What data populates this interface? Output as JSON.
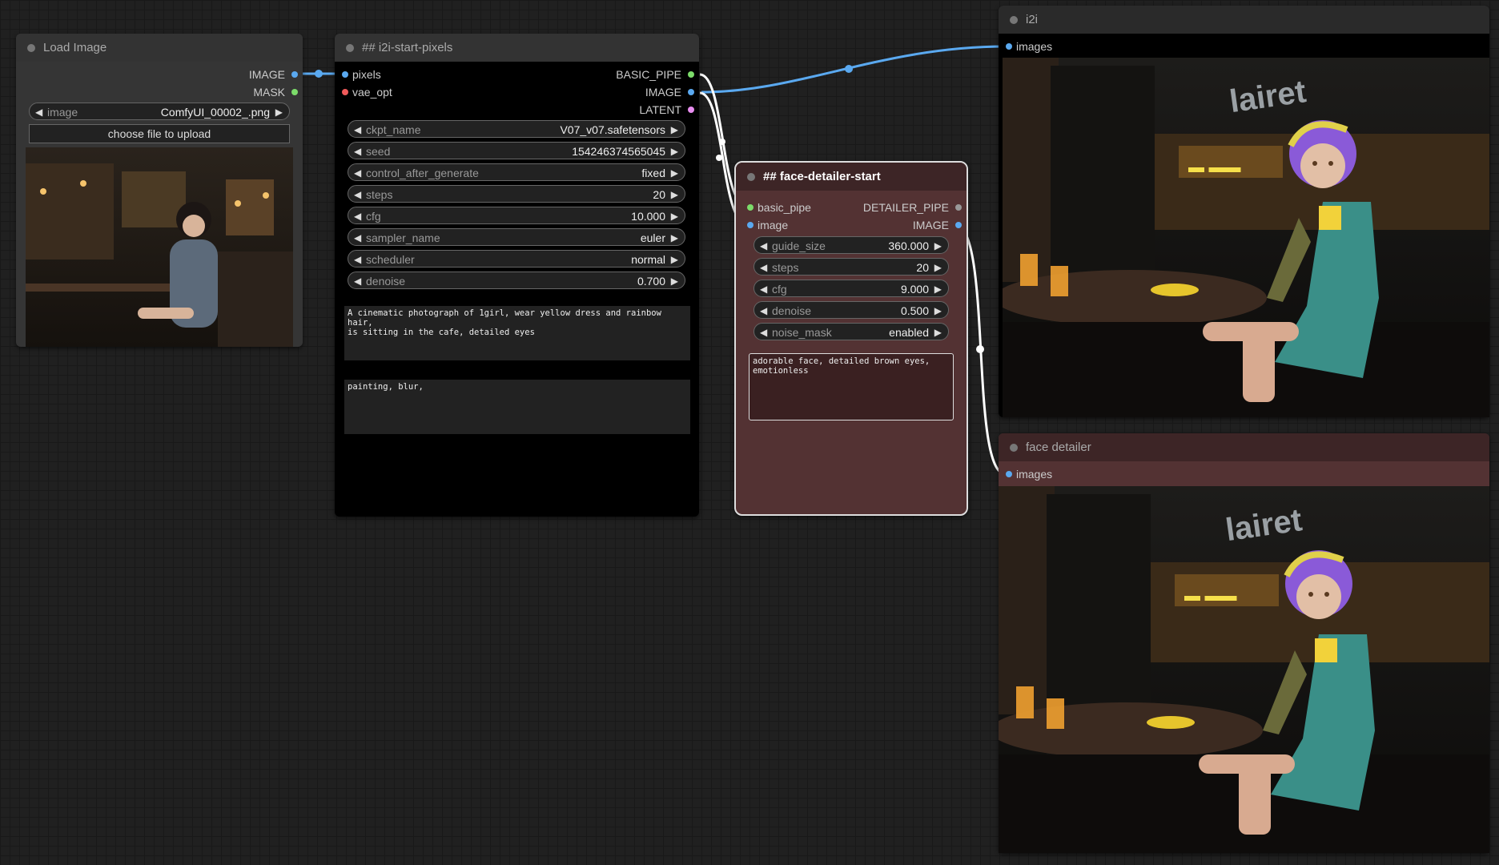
{
  "colors": {
    "canvas": "#202020",
    "image_link": "#5aa9f0",
    "latent": "#e88ef0",
    "mask": "#7cdc6a",
    "vae": "#f05a5a",
    "detailer_node": "#533233"
  },
  "nodes": {
    "load_image": {
      "title": "Load Image",
      "outputs": [
        "IMAGE",
        "MASK"
      ],
      "image_widget": {
        "label": "image",
        "value": "ComfyUI_00002_.png"
      },
      "upload_label": "choose file to upload"
    },
    "i2i_start": {
      "title": "## i2i-start-pixels",
      "inputs": [
        "pixels",
        "vae_opt"
      ],
      "outputs": [
        "BASIC_PIPE",
        "IMAGE",
        "LATENT"
      ],
      "widgets": [
        {
          "label": "ckpt_name",
          "value": "V07_v07.safetensors"
        },
        {
          "label": "seed",
          "value": "154246374565045"
        },
        {
          "label": "control_after_generate",
          "value": "fixed"
        },
        {
          "label": "steps",
          "value": "20"
        },
        {
          "label": "cfg",
          "value": "10.000"
        },
        {
          "label": "sampler_name",
          "value": "euler"
        },
        {
          "label": "scheduler",
          "value": "normal"
        },
        {
          "label": "denoise",
          "value": "0.700"
        }
      ],
      "positive_prompt": "A cinematic photograph of 1girl, wear yellow dress and rainbow hair,\nis sitting in the cafe, detailed eyes",
      "negative_prompt": "painting, blur,"
    },
    "face_detailer": {
      "title": "## face-detailer-start",
      "inputs": [
        "basic_pipe",
        "image"
      ],
      "outputs": [
        "DETAILER_PIPE",
        "IMAGE"
      ],
      "widgets": [
        {
          "label": "guide_size",
          "value": "360.000"
        },
        {
          "label": "steps",
          "value": "20"
        },
        {
          "label": "cfg",
          "value": "9.000"
        },
        {
          "label": "denoise",
          "value": "0.500"
        },
        {
          "label": "noise_mask",
          "value": "enabled"
        }
      ],
      "prompt": "adorable face, detailed brown eyes,\nemotionless"
    },
    "preview_i2i": {
      "title": "i2i",
      "input": "images"
    },
    "preview_face": {
      "title": "face detailer",
      "input": "images"
    }
  },
  "arrows": {
    "left": "◀",
    "right": "▶"
  }
}
